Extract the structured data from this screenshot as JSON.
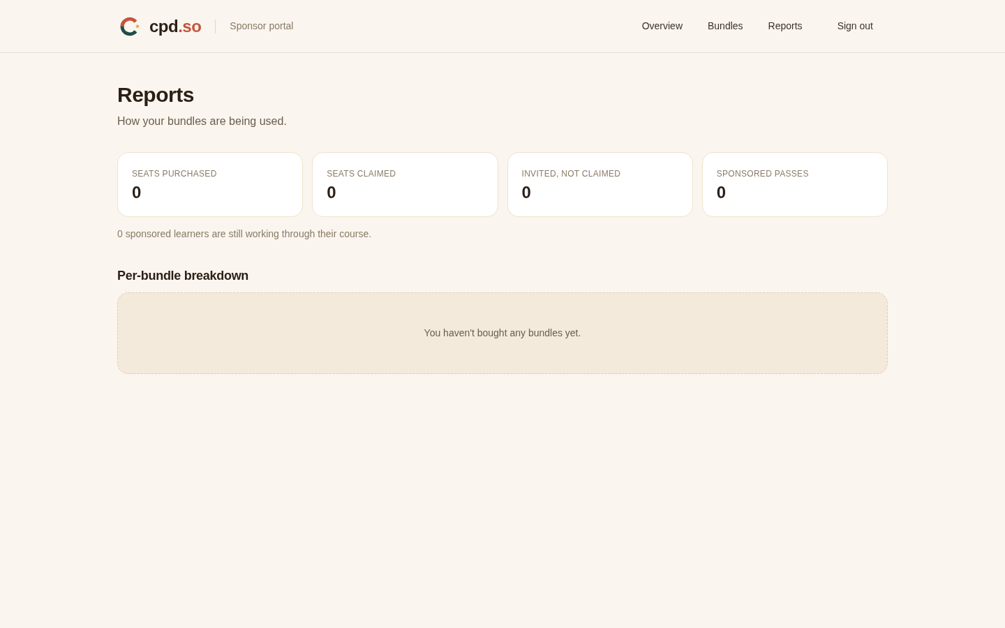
{
  "header": {
    "logo": {
      "text": "cpd",
      "accent": ".so"
    },
    "portal_label": "Sponsor portal",
    "nav": [
      {
        "label": "Overview"
      },
      {
        "label": "Bundles"
      },
      {
        "label": "Reports"
      }
    ],
    "sign_out": "Sign out"
  },
  "page": {
    "title": "Reports",
    "subtitle": "How your bundles are being used."
  },
  "stats": [
    {
      "label": "SEATS PURCHASED",
      "value": "0"
    },
    {
      "label": "SEATS CLAIMED",
      "value": "0"
    },
    {
      "label": "INVITED, NOT CLAIMED",
      "value": "0"
    },
    {
      "label": "SPONSORED PASSES",
      "value": "0"
    }
  ],
  "note": "0 sponsored learners are still working through their course.",
  "breakdown": {
    "title": "Per-bundle breakdown",
    "empty_message": "You haven't bought any bundles yet."
  }
}
